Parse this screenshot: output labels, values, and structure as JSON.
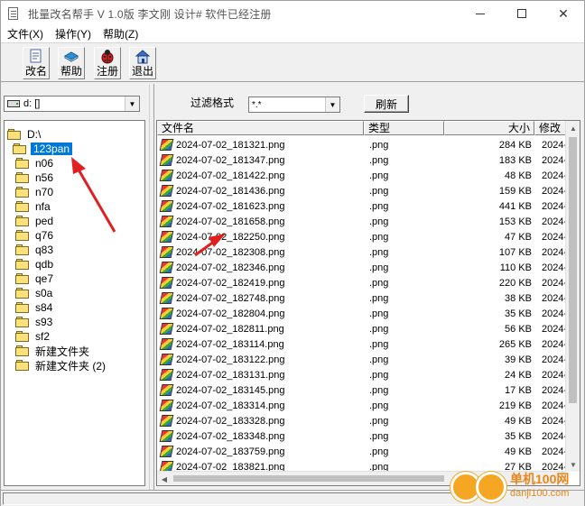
{
  "window": {
    "title": "批量改名帮手  V 1.0版  李文刚 设计#  软件已经注册"
  },
  "menu": [
    "文件(X)",
    "操作(Y)",
    "帮助(Z)"
  ],
  "toolbar": {
    "rename": "改名",
    "help": "帮助",
    "register": "注册",
    "exit": "退出"
  },
  "drive": {
    "value": "d: []"
  },
  "tree": {
    "root": "D:\\",
    "items": [
      "123pan",
      "n06",
      "n56",
      "n70",
      "nfa",
      "ped",
      "q76",
      "q83",
      "qdb",
      "qe7",
      "s0a",
      "s84",
      "s93",
      "sf2",
      "新建文件夹",
      "新建文件夹 (2)"
    ],
    "selected": "123pan"
  },
  "filter": {
    "label": "过滤格式",
    "value": "*.*",
    "refresh": "刷新"
  },
  "columns": [
    "文件名",
    "类型",
    "大小",
    "修改"
  ],
  "files": [
    {
      "name": "2024-07-02_181321.png",
      "type": ".png",
      "size": "284 KB",
      "mod": "2024-"
    },
    {
      "name": "2024-07-02_181347.png",
      "type": ".png",
      "size": "183 KB",
      "mod": "2024-"
    },
    {
      "name": "2024-07-02_181422.png",
      "type": ".png",
      "size": "48 KB",
      "mod": "2024-"
    },
    {
      "name": "2024-07-02_181436.png",
      "type": ".png",
      "size": "159 KB",
      "mod": "2024-"
    },
    {
      "name": "2024-07-02_181623.png",
      "type": ".png",
      "size": "441 KB",
      "mod": "2024-"
    },
    {
      "name": "2024-07-02_181658.png",
      "type": ".png",
      "size": "153 KB",
      "mod": "2024-"
    },
    {
      "name": "2024-07-02_182250.png",
      "type": ".png",
      "size": "47 KB",
      "mod": "2024-"
    },
    {
      "name": "2024-07-02_182308.png",
      "type": ".png",
      "size": "107 KB",
      "mod": "2024-"
    },
    {
      "name": "2024-07-02_182346.png",
      "type": ".png",
      "size": "110 KB",
      "mod": "2024-"
    },
    {
      "name": "2024-07-02_182419.png",
      "type": ".png",
      "size": "220 KB",
      "mod": "2024-"
    },
    {
      "name": "2024-07-02_182748.png",
      "type": ".png",
      "size": "38 KB",
      "mod": "2024-"
    },
    {
      "name": "2024-07-02_182804.png",
      "type": ".png",
      "size": "35 KB",
      "mod": "2024-"
    },
    {
      "name": "2024-07-02_182811.png",
      "type": ".png",
      "size": "56 KB",
      "mod": "2024-"
    },
    {
      "name": "2024-07-02_183114.png",
      "type": ".png",
      "size": "265 KB",
      "mod": "2024-"
    },
    {
      "name": "2024-07-02_183122.png",
      "type": ".png",
      "size": "39 KB",
      "mod": "2024-"
    },
    {
      "name": "2024-07-02_183131.png",
      "type": ".png",
      "size": "24 KB",
      "mod": "2024-"
    },
    {
      "name": "2024-07-02_183145.png",
      "type": ".png",
      "size": "17 KB",
      "mod": "2024-"
    },
    {
      "name": "2024-07-02_183314.png",
      "type": ".png",
      "size": "219 KB",
      "mod": "2024-"
    },
    {
      "name": "2024-07-02_183328.png",
      "type": ".png",
      "size": "49 KB",
      "mod": "2024-"
    },
    {
      "name": "2024-07-02_183348.png",
      "type": ".png",
      "size": "35 KB",
      "mod": "2024-"
    },
    {
      "name": "2024-07-02_183759.png",
      "type": ".png",
      "size": "49 KB",
      "mod": "2024-"
    },
    {
      "name": "2024-07-02_183821.png",
      "type": ".png",
      "size": "27 KB",
      "mod": "2024-"
    }
  ],
  "watermark": {
    "text": "单机100网",
    "url": "danji100.com"
  },
  "colors": {
    "selection": "#0078d7",
    "annotation_arrow": "#e02020",
    "folder": "#fce17a"
  }
}
